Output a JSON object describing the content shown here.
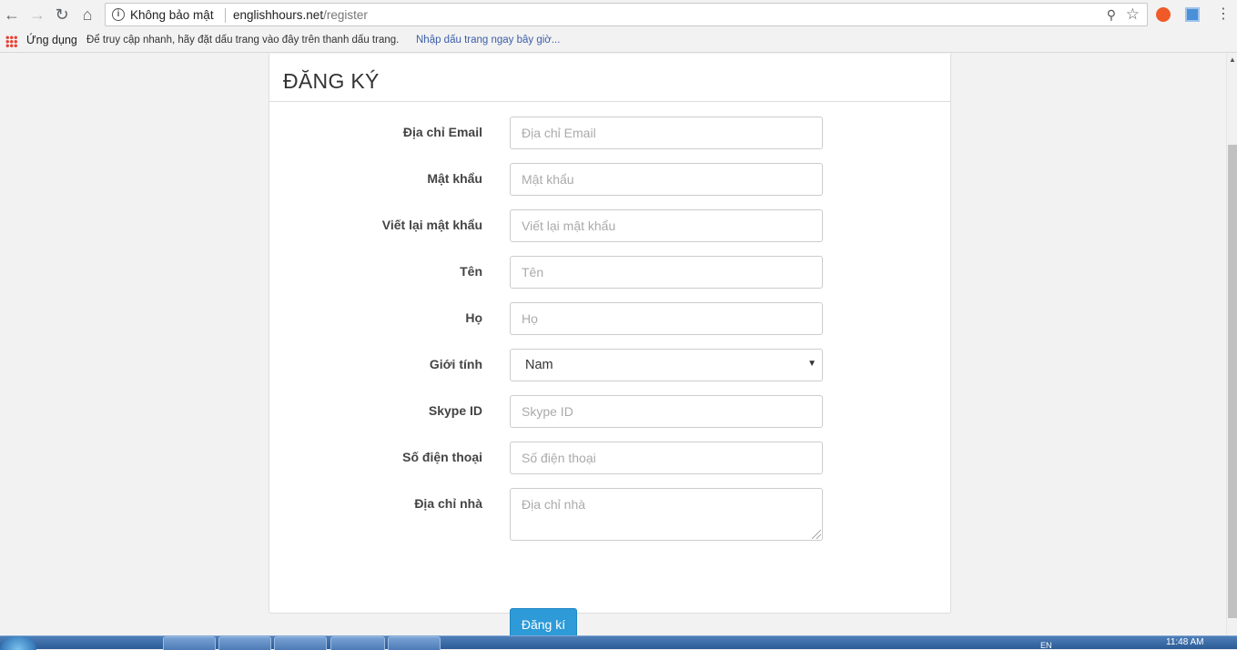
{
  "browser": {
    "security_text": "Không bảo mật",
    "url_host": "englishhours.net",
    "url_path": "/register",
    "bookmarks": {
      "apps_label": "Ứng dụng",
      "hint": "Để truy cập nhanh, hãy đặt dấu trang vào đây trên thanh dấu trang.",
      "import_link": "Nhập dấu trang ngay bây giờ..."
    }
  },
  "page": {
    "title": "ĐĂNG KÝ",
    "form": {
      "email": {
        "label": "Địa chỉ Email",
        "placeholder": "Địa chỉ Email"
      },
      "password": {
        "label": "Mật khẩu",
        "placeholder": "Mật khẩu"
      },
      "password_confirm": {
        "label": "Viết lại mật khẩu",
        "placeholder": "Viết lại mật khẩu"
      },
      "first_name": {
        "label": "Tên",
        "placeholder": "Tên"
      },
      "last_name": {
        "label": "Họ",
        "placeholder": "Họ"
      },
      "gender": {
        "label": "Giới tính",
        "value": "Nam"
      },
      "skype": {
        "label": "Skype ID",
        "placeholder": "Skype ID"
      },
      "phone": {
        "label": "Số điện thoại",
        "placeholder": "Số điện thoại"
      },
      "address": {
        "label": "Địa chỉ nhà",
        "placeholder": "Địa chỉ nhà"
      },
      "submit_label": "Đăng kí"
    }
  },
  "taskbar": {
    "clock": "11:48 AM",
    "language": "EN"
  },
  "colors": {
    "accent": "#2e9ad8",
    "background": "#f2f2f2"
  }
}
